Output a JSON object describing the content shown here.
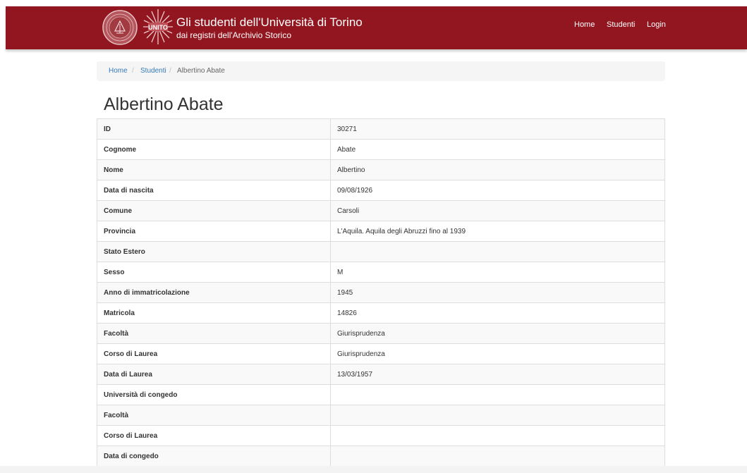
{
  "header": {
    "title": "Gli studenti dell'Università di Torino",
    "subtitle": "dai registri dell'Archivio Storico",
    "logo_text": "UNITO",
    "nav": [
      "Home",
      "Studenti",
      "Login"
    ],
    "brand_color": "#92161f"
  },
  "breadcrumb": {
    "items": [
      "Home",
      "Studenti",
      "Albertino Abate"
    ],
    "separator": "/"
  },
  "page_title": "Albertino Abate",
  "details": [
    {
      "label": "ID",
      "value": "30271"
    },
    {
      "label": "Cognome",
      "value": "Abate"
    },
    {
      "label": "Nome",
      "value": "Albertino"
    },
    {
      "label": "Data di nascita",
      "value": "09/08/1926"
    },
    {
      "label": "Comune",
      "value": "Carsoli"
    },
    {
      "label": "Provincia",
      "value": "L'Aquila. Aquila degli Abruzzi fino al 1939"
    },
    {
      "label": "Stato Estero",
      "value": ""
    },
    {
      "label": "Sesso",
      "value": "M"
    },
    {
      "label": "Anno di immatricolazione",
      "value": "1945"
    },
    {
      "label": "Matricola",
      "value": "14826"
    },
    {
      "label": "Facoltà",
      "value": "Giurisprudenza"
    },
    {
      "label": "Corso di Laurea",
      "value": "Giurisprudenza"
    },
    {
      "label": "Data di Laurea",
      "value": "13/03/1957"
    },
    {
      "label": "Università di congedo",
      "value": ""
    },
    {
      "label": "Facoltà",
      "value": ""
    },
    {
      "label": "Corso di Laurea",
      "value": ""
    },
    {
      "label": "Data di congedo",
      "value": ""
    }
  ]
}
